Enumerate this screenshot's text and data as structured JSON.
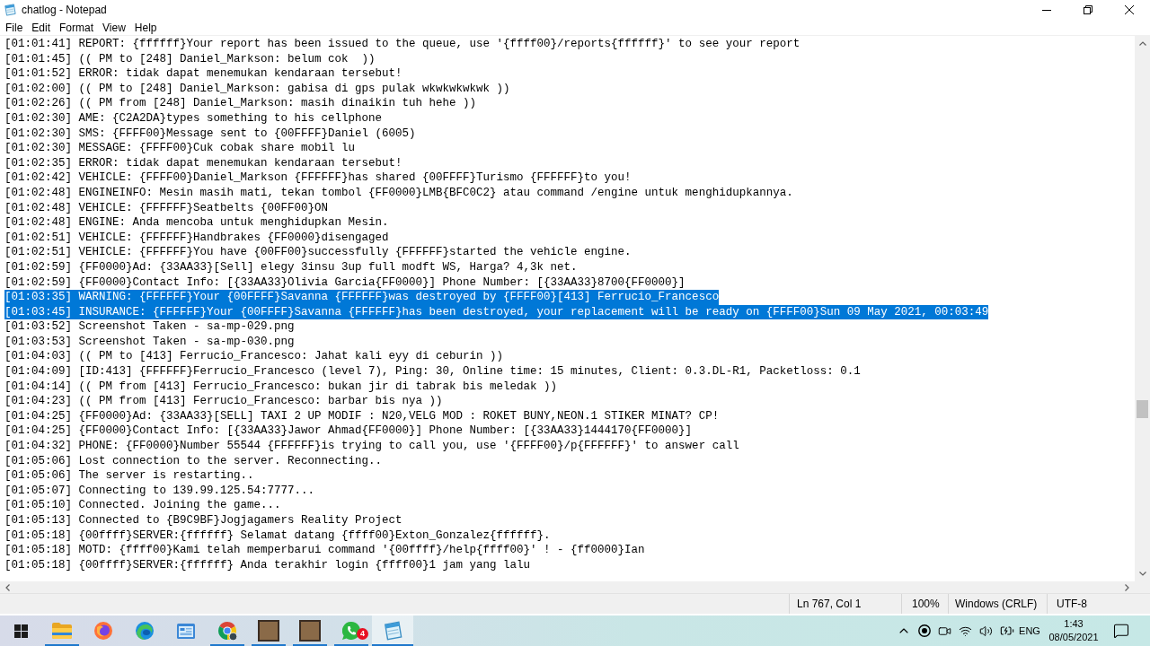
{
  "window": {
    "title": "chatlog - Notepad"
  },
  "menu": [
    "File",
    "Edit",
    "Format",
    "View",
    "Help"
  ],
  "editor": {
    "lines": [
      {
        "text": "[01:01:41] REPORT: {ffffff}Your report has been issued to the queue, use '{ffff00}/reports{ffffff}' to see your report",
        "selected": false
      },
      {
        "text": "[01:01:45] (( PM to [248] Daniel_Markson: belum cok  ))",
        "selected": false
      },
      {
        "text": "[01:01:52] ERROR: tidak dapat menemukan kendaraan tersebut!",
        "selected": false
      },
      {
        "text": "[01:02:00] (( PM to [248] Daniel_Markson: gabisa di gps pulak wkwkwkwkwk ))",
        "selected": false
      },
      {
        "text": "[01:02:26] (( PM from [248] Daniel_Markson: masih dinaikin tuh hehe ))",
        "selected": false
      },
      {
        "text": "[01:02:30] AME: {C2A2DA}types something to his cellphone",
        "selected": false
      },
      {
        "text": "[01:02:30] SMS: {FFFF00}Message sent to {00FFFF}Daniel (6005)",
        "selected": false
      },
      {
        "text": "[01:02:30] MESSAGE: {FFFF00}Cuk cobak share mobil lu",
        "selected": false
      },
      {
        "text": "[01:02:35] ERROR: tidak dapat menemukan kendaraan tersebut!",
        "selected": false
      },
      {
        "text": "[01:02:42] VEHICLE: {FFFF00}Daniel_Markson {FFFFFF}has shared {00FFFF}Turismo {FFFFFF}to you!",
        "selected": false
      },
      {
        "text": "[01:02:48] ENGINEINFO: Mesin masih mati, tekan tombol {FF0000}LMB{BFC0C2} atau command /engine untuk menghidupkannya.",
        "selected": false
      },
      {
        "text": "[01:02:48] VEHICLE: {FFFFFF}Seatbelts {00FF00}ON",
        "selected": false
      },
      {
        "text": "[01:02:48] ENGINE: Anda mencoba untuk menghidupkan Mesin.",
        "selected": false
      },
      {
        "text": "[01:02:51] VEHICLE: {FFFFFF}Handbrakes {FF0000}disengaged",
        "selected": false
      },
      {
        "text": "[01:02:51] VEHICLE: {FFFFFF}You have {00FF00}successfully {FFFFFF}started the vehicle engine.",
        "selected": false
      },
      {
        "text": "[01:02:59] {FF0000}Ad: {33AA33}[Sell] elegy 3insu 3up full modft WS, Harga? 4,3k net.",
        "selected": false
      },
      {
        "text": "[01:02:59] {FF0000}Contact Info: [{33AA33}Olivia Garcia{FF0000}] Phone Number: [{33AA33}8700{FF0000}]",
        "selected": false
      },
      {
        "text": "[01:03:35] WARNING: {FFFFFF}Your {00FFFF}Savanna {FFFFFF}was destroyed by {FFFF00}[413] Ferrucio_Francesco",
        "selected": true
      },
      {
        "text": "[01:03:45] INSURANCE: {FFFFFF}Your {00FFFF}Savanna {FFFFFF}has been destroyed, your replacement will be ready on {FFFF00}Sun 09 May 2021, 00:03:49",
        "selected": true
      },
      {
        "text": "[01:03:52] Screenshot Taken - sa-mp-029.png",
        "selected": false
      },
      {
        "text": "[01:03:53] Screenshot Taken - sa-mp-030.png",
        "selected": false
      },
      {
        "text": "[01:04:03] (( PM to [413] Ferrucio_Francesco: Jahat kali eyy di ceburin ))",
        "selected": false
      },
      {
        "text": "[01:04:09] [ID:413] {FFFFFF}Ferrucio_Francesco (level 7), Ping: 30, Online time: 15 minutes, Client: 0.3.DL-R1, Packetloss: 0.1",
        "selected": false
      },
      {
        "text": "[01:04:14] (( PM from [413] Ferrucio_Francesco: bukan jir di tabrak bis meledak ))",
        "selected": false
      },
      {
        "text": "[01:04:23] (( PM from [413] Ferrucio_Francesco: barbar bis nya ))",
        "selected": false
      },
      {
        "text": "[01:04:25] {FF0000}Ad: {33AA33}[SELL] TAXI 2 UP MODIF : N20,VELG MOD : ROKET BUNY,NEON.1 STIKER MINAT? CP!",
        "selected": false
      },
      {
        "text": "[01:04:25] {FF0000}Contact Info: [{33AA33}Jawor Ahmad{FF0000}] Phone Number: [{33AA33}1444170{FF0000}]",
        "selected": false
      },
      {
        "text": "[01:04:32] PHONE: {FF0000}Number 55544 {FFFFFF}is trying to call you, use '{FFFF00}/p{FFFFFF}' to answer call",
        "selected": false
      },
      {
        "text": "[01:05:06] Lost connection to the server. Reconnecting..",
        "selected": false
      },
      {
        "text": "[01:05:06] The server is restarting..",
        "selected": false
      },
      {
        "text": "[01:05:07] Connecting to 139.99.125.54:7777...",
        "selected": false
      },
      {
        "text": "[01:05:10] Connected. Joining the game...",
        "selected": false
      },
      {
        "text": "[01:05:13] Connected to {B9C9BF}Jogjagamers Reality Project",
        "selected": false
      },
      {
        "text": "[01:05:18] {00ffff}SERVER:{ffffff} Selamat datang {ffff00}Exton_Gonzalez{ffffff}.",
        "selected": false
      },
      {
        "text": "[01:05:18] MOTD: {ffff00}Kami telah memperbarui command '{00ffff}/help{ffff00}' ! - {ff0000}Ian",
        "selected": false
      },
      {
        "text": "[01:05:18] {00ffff}SERVER:{ffffff} Anda terakhir login {ffff00}1 jam yang lalu",
        "selected": false
      }
    ]
  },
  "status_bar": {
    "position": "Ln 767, Col 1",
    "zoom": "100%",
    "line_ending": "Windows (CRLF)",
    "encoding": "UTF-8"
  },
  "taskbar": {
    "apps": [
      {
        "kind": "explorer",
        "running": true,
        "selected": false
      },
      {
        "kind": "firefox",
        "running": false,
        "selected": false
      },
      {
        "kind": "edge",
        "running": false,
        "selected": false
      },
      {
        "kind": "panel",
        "running": false,
        "selected": false
      },
      {
        "kind": "chrome",
        "running": true,
        "selected": false
      },
      {
        "kind": "game",
        "running": true,
        "selected": false
      },
      {
        "kind": "game",
        "running": true,
        "selected": false
      },
      {
        "kind": "whatsapp",
        "running": true,
        "selected": false,
        "badge": "4"
      },
      {
        "kind": "notepad",
        "running": true,
        "selected": true
      }
    ],
    "tray": {
      "language": "ENG",
      "time": "1:43",
      "date": "08/05/2021"
    }
  }
}
